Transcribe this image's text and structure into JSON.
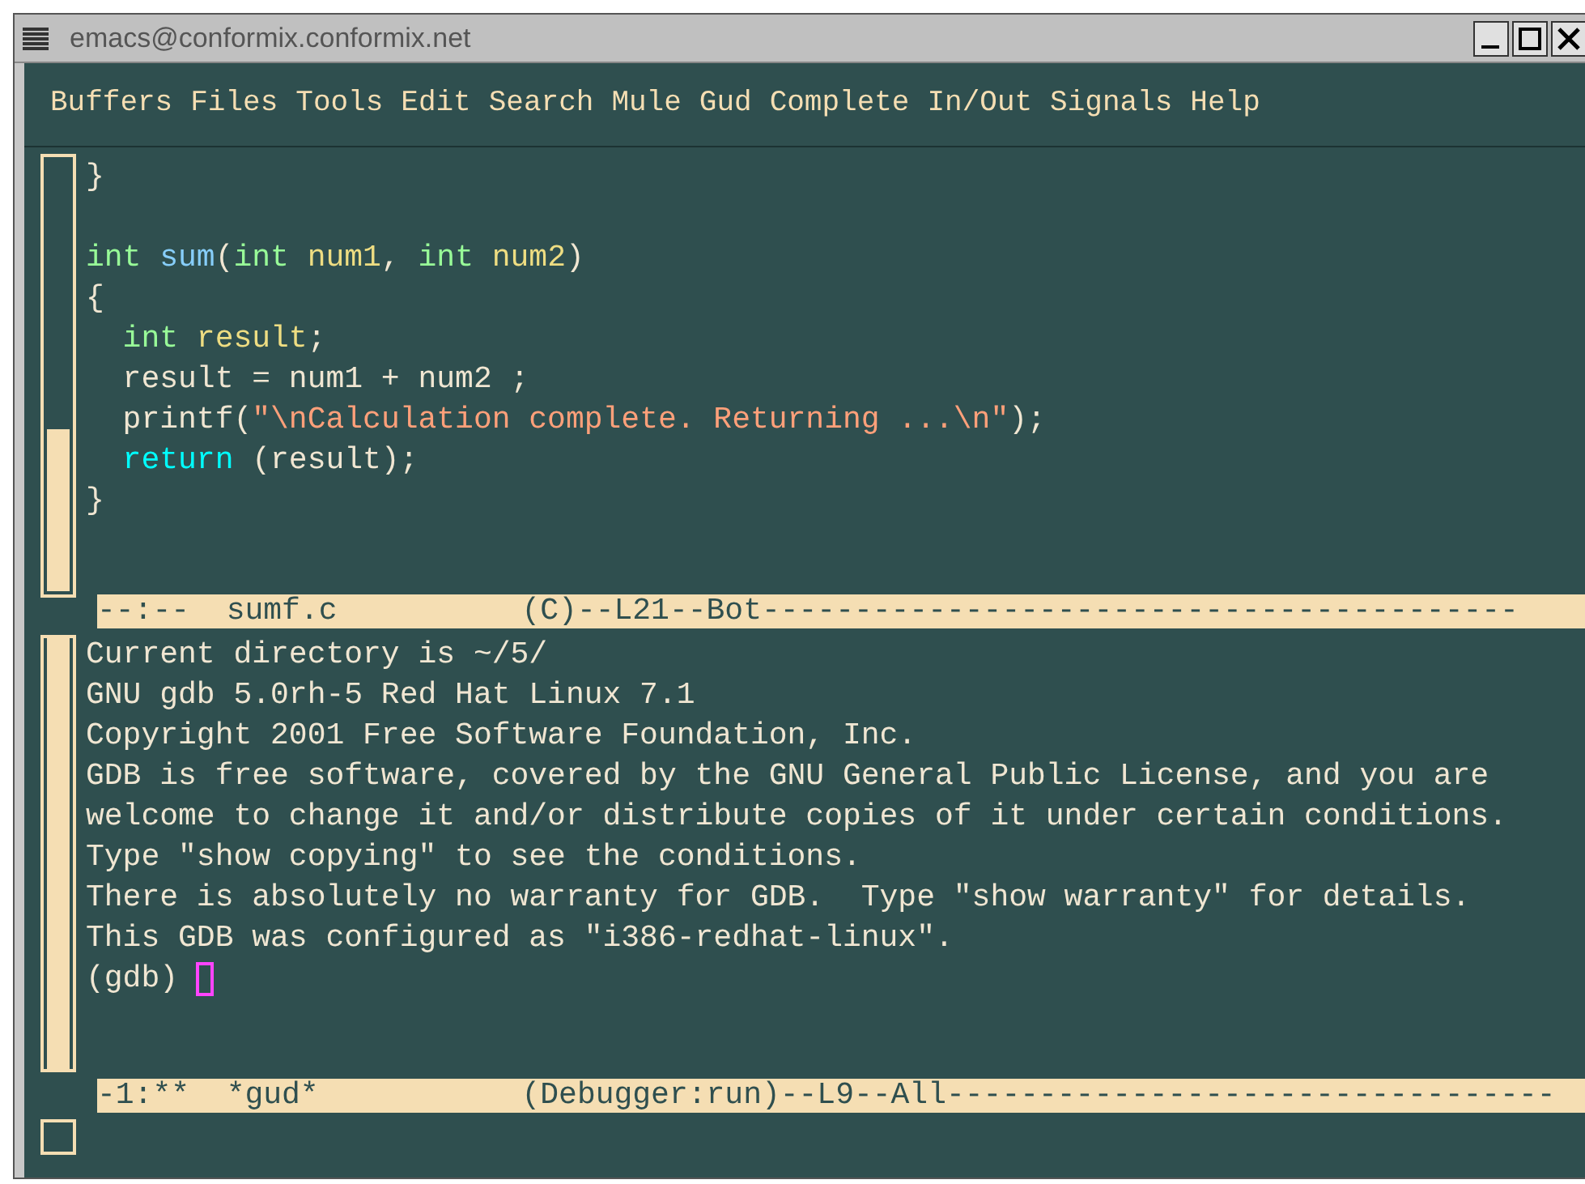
{
  "window": {
    "title": "emacs@conformix.conformix.net"
  },
  "menu": [
    "Buffers",
    "Files",
    "Tools",
    "Edit",
    "Search",
    "Mule",
    "Gud",
    "Complete",
    "In/Out",
    "Signals",
    "Help"
  ],
  "code": {
    "lines": [
      {
        "kind": "code",
        "tokens": [
          {
            "kind": "plain",
            "text": "}"
          }
        ]
      },
      {
        "kind": "blank"
      },
      {
        "kind": "code",
        "tokens": [
          {
            "kind": "type",
            "text": "int "
          },
          {
            "kind": "function",
            "text": "sum"
          },
          {
            "kind": "plain",
            "text": "("
          },
          {
            "kind": "type",
            "text": "int "
          },
          {
            "kind": "variable",
            "text": "num1"
          },
          {
            "kind": "plain",
            "text": ", "
          },
          {
            "kind": "type",
            "text": "int "
          },
          {
            "kind": "variable",
            "text": "num2"
          },
          {
            "kind": "plain",
            "text": ")"
          }
        ]
      },
      {
        "kind": "code",
        "tokens": [
          {
            "kind": "plain",
            "text": "{"
          }
        ]
      },
      {
        "kind": "code",
        "tokens": [
          {
            "kind": "type",
            "text": "  int "
          },
          {
            "kind": "variable",
            "text": "result"
          },
          {
            "kind": "plain",
            "text": ";"
          }
        ]
      },
      {
        "kind": "code",
        "tokens": [
          {
            "kind": "plain",
            "text": "  result = num1 + num2 ;"
          }
        ]
      },
      {
        "kind": "code",
        "tokens": [
          {
            "kind": "plain",
            "text": "  printf("
          },
          {
            "kind": "string",
            "text": "\"\\nCalculation complete. Returning ...\\n\""
          },
          {
            "kind": "plain",
            "text": ");"
          }
        ]
      },
      {
        "kind": "code",
        "tokens": [
          {
            "kind": "keyword",
            "text": "  return"
          },
          {
            "kind": "plain",
            "text": " (result);"
          }
        ]
      },
      {
        "kind": "code",
        "tokens": [
          {
            "kind": "plain",
            "text": "}"
          }
        ]
      }
    ],
    "mode_line": "--:--  sumf.c          (C)--L21--Bot-----------------------------------------"
  },
  "gud": {
    "lines": [
      "Current directory is ~/5/",
      "GNU gdb 5.0rh-5 Red Hat Linux 7.1",
      "Copyright 2001 Free Software Foundation, Inc.",
      "GDB is free software, covered by the GNU General Public License, and you are",
      "welcome to change it and/or distribute copies of it under certain conditions.",
      "Type \"show copying\" to see the conditions.",
      "There is absolutely no warranty for GDB.  Type \"show warranty\" for details.",
      "This GDB was configured as \"i386-redhat-linux\"."
    ],
    "prompt": "(gdb)",
    "mode_line": "-1:**  *gud*           (Debugger:run)--L9--All---------------------------------"
  }
}
